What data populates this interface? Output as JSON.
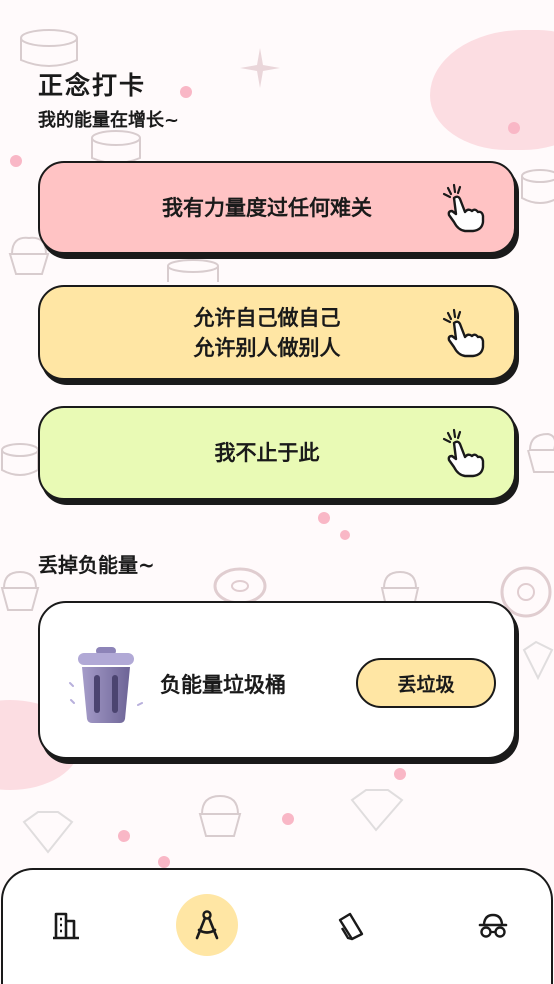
{
  "header": {
    "title": "正念打卡",
    "subtitle": "我的能量在增长~"
  },
  "affirmations": [
    {
      "lines": [
        "我有力量度过任何难关"
      ],
      "color": "#ffc3c4",
      "icon": "tap-hand-icon"
    },
    {
      "lines": [
        "允许自己做自己",
        "允许别人做别人"
      ],
      "color": "#ffe6a4",
      "icon": "tap-hand-icon"
    },
    {
      "lines": [
        "我不止于此"
      ],
      "color": "#e9fab5",
      "icon": "tap-hand-icon"
    }
  ],
  "negative_section": {
    "title": "丢掉负能量~",
    "card_label": "负能量垃圾桶",
    "button_label": "丢垃圾",
    "icon": "trash-bin-icon"
  },
  "tabbar": {
    "tabs": [
      {
        "icon": "building-icon",
        "active": false
      },
      {
        "icon": "compass-tool-icon",
        "active": true
      },
      {
        "icon": "cards-icon",
        "active": false
      },
      {
        "icon": "glasses-hat-icon",
        "active": false
      }
    ],
    "active_color": "#ffe6a4"
  }
}
